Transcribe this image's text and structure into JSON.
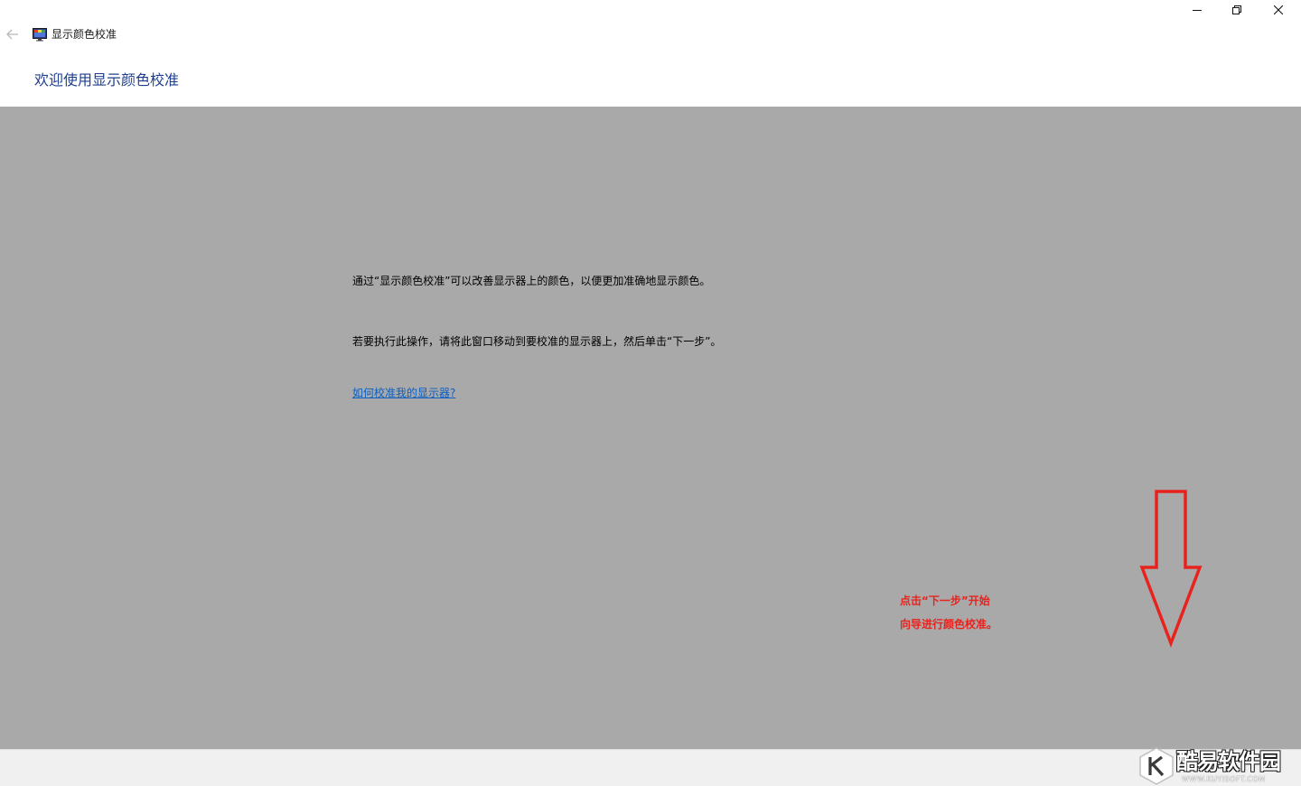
{
  "window": {
    "title": "显示颜色校准"
  },
  "header": {
    "heading": "欢迎使用显示颜色校准"
  },
  "content": {
    "intro": "通过“显示颜色校准”可以改善显示器上的颜色，以便更加准确地显示颜色。",
    "instruction": "若要执行此操作，请将此窗口移动到要校准的显示器上，然后单击“下一步”。",
    "help_link": "如何校准我的显示器?"
  },
  "annotation": {
    "line1": "点击“下一步”开始",
    "line2": "向导进行颜色校准。",
    "color": "#e8231e"
  },
  "watermark": {
    "name": "酷易软件园",
    "url": "WWW.KUYISOFT.COM"
  },
  "icons": {
    "back": "arrow-left-icon",
    "app": "display-calibration-icon",
    "minimize": "minimize-icon",
    "restore": "restore-icon",
    "close": "close-icon",
    "annotation_arrow": "arrow-down-icon"
  },
  "colors": {
    "heading": "#1e3f8f",
    "content_bg": "#a9a9a9",
    "link": "#0b5fc2",
    "footer_bg": "#f0f0f0"
  }
}
